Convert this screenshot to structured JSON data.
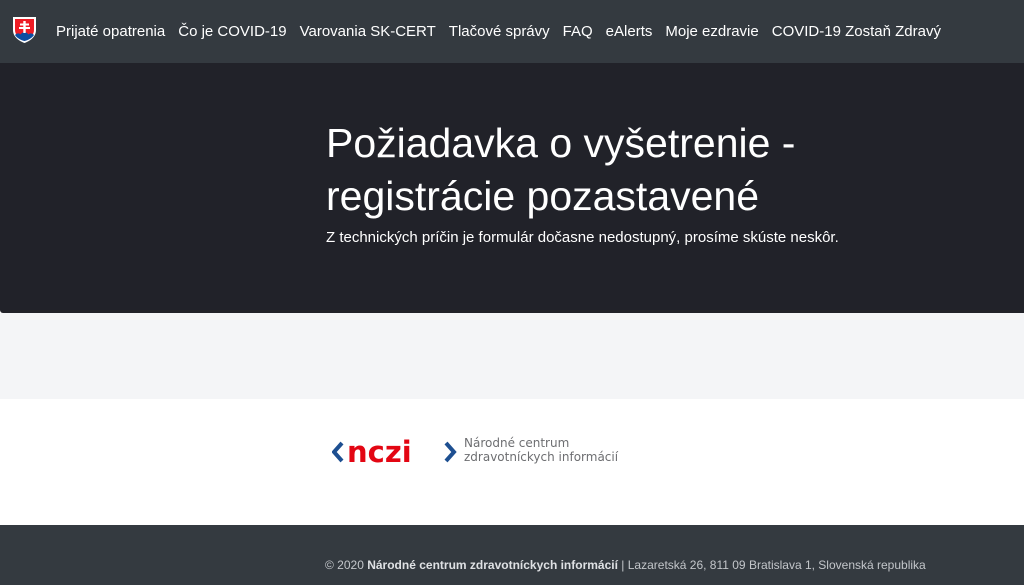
{
  "nav": {
    "items": [
      {
        "label": "Prijaté opatrenia"
      },
      {
        "label": "Čo je COVID-19"
      },
      {
        "label": "Varovania SK-CERT"
      },
      {
        "label": "Tlačové správy"
      },
      {
        "label": "FAQ"
      },
      {
        "label": "eAlerts"
      },
      {
        "label": "Moje ezdravie"
      },
      {
        "label": "COVID-19 Zostaň Zdravý"
      }
    ]
  },
  "hero": {
    "title_line1": "Požiadavka o vyšetrenie -",
    "title_line2": "registrácie pozastavené",
    "subtitle": "Z technických príčin je formulár dočasne nedostupný, prosíme skúste neskôr."
  },
  "logo": {
    "mark_text": "nczi",
    "tagline_line1": "Národné centrum",
    "tagline_line2": "zdravotníckych informácií",
    "colors": {
      "red": "#e30613",
      "blue": "#1d4f91"
    }
  },
  "footer": {
    "copyright": "© 2020",
    "org": "Národné centrum zdravotníckych informácií",
    "address": "| Lazaretská 26, 811 09 Bratislava 1, Slovenská republika"
  },
  "colors": {
    "nav_bg": "#343a40",
    "hero_bg": "#212229",
    "band_bg": "#f4f5f7",
    "footer_bg": "#343a40"
  }
}
